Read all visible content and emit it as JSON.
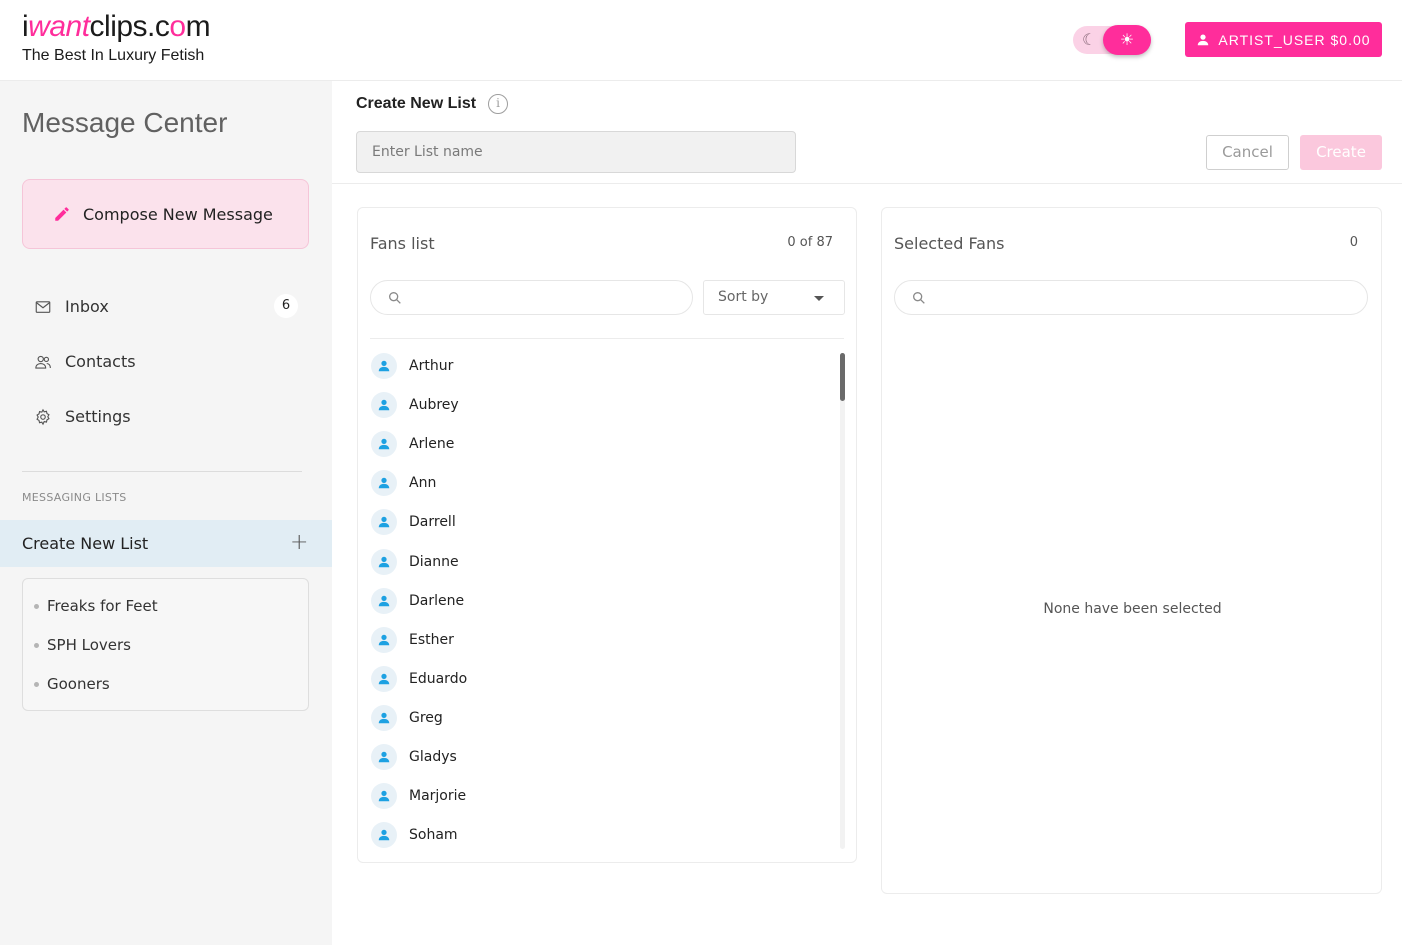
{
  "header": {
    "logo_part1": "i",
    "logo_part2": "want",
    "logo_part3": "clips.c",
    "logo_part4": "o",
    "logo_part5": "m",
    "tagline": "The Best In Luxury Fetish",
    "user_button_label": "ARTIST_USER $0.00"
  },
  "sidebar": {
    "title": "Message Center",
    "compose_label": "Compose New Message",
    "nav": [
      {
        "label": "Inbox",
        "icon": "mail-icon",
        "badge": "6"
      },
      {
        "label": "Contacts",
        "icon": "people-icon"
      },
      {
        "label": "Settings",
        "icon": "gear-icon"
      }
    ],
    "messaging_lists_label": "MESSAGING LISTS",
    "create_new_list_label": "Create New List",
    "lists": [
      "Freaks for Feet",
      "SPH Lovers",
      "Gooners"
    ]
  },
  "main": {
    "title": "Create New List",
    "list_name_placeholder": "Enter List name",
    "cancel_label": "Cancel",
    "create_label": "Create",
    "fans_panel": {
      "title": "Fans list",
      "count": "0 of 87",
      "sort_label": "Sort by",
      "fans": [
        "Arthur",
        "Aubrey",
        "Arlene",
        "Ann",
        "Darrell",
        "Dianne",
        "Darlene",
        "Esther",
        "Eduardo",
        "Greg",
        "Gladys",
        "Marjorie",
        "Soham"
      ]
    },
    "selected_panel": {
      "title": "Selected Fans",
      "count": "0",
      "empty_message": "None have been selected"
    }
  },
  "colors": {
    "brand_pink": "#ff2d9b",
    "avatar_blue": "#1da1e2"
  }
}
